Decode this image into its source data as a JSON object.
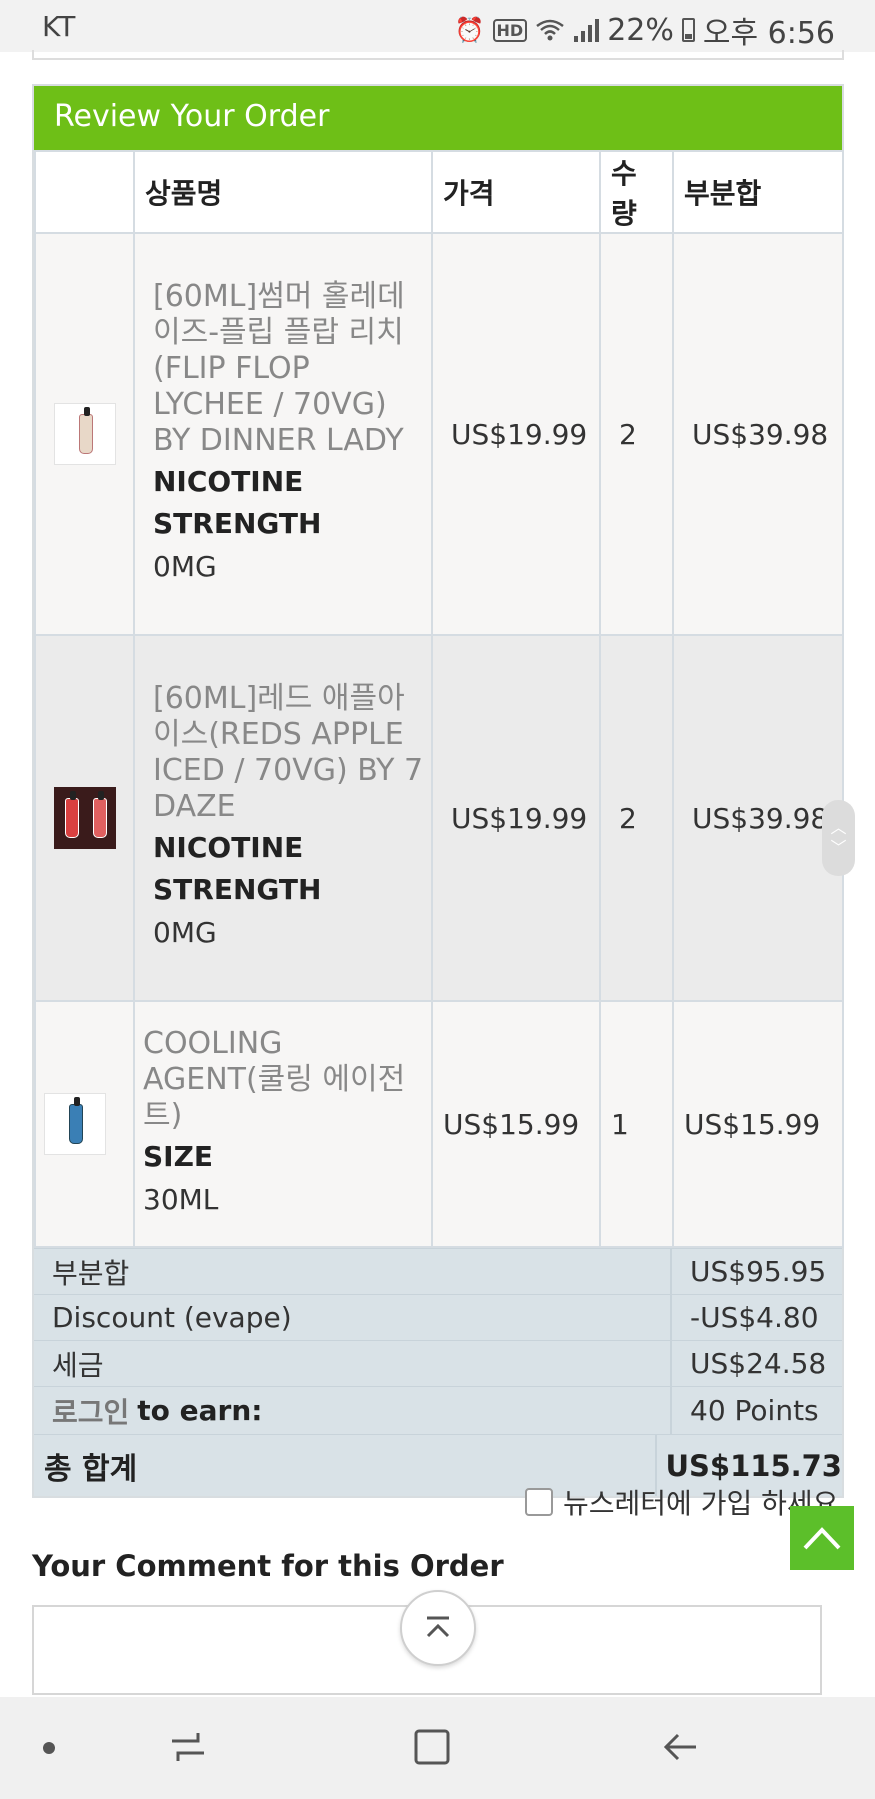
{
  "status_bar": {
    "carrier": "KT",
    "battery": "22%",
    "time": "오후 6:56",
    "icons": [
      "alarm-icon",
      "hd-icon",
      "wifi-icon",
      "signal-icon",
      "battery-icon"
    ]
  },
  "panel": {
    "title": "Review Your Order",
    "header_color": "#6ebf17"
  },
  "table": {
    "headers": [
      "상품명",
      "가격",
      "수량",
      "부분합"
    ],
    "rows": [
      {
        "name": "[60ML]썸머 홀레데이즈-플립 플랍 리치(FLIP FLOP LYCHEE / 70VG) BY DINNER LADY",
        "attr_label": "NICOTINE STRENGTH",
        "attr_value": "0MG",
        "price": "US$19.99",
        "qty": "2",
        "subtotal": "US$39.98"
      },
      {
        "name": "[60ML]레드 애플아이스(REDS APPLE ICED / 70VG) BY 7 DAZE",
        "attr_label": "NICOTINE STRENGTH",
        "attr_value": "0MG",
        "price": "US$19.99",
        "qty": "2",
        "subtotal": "US$39.98"
      },
      {
        "name": "COOLING AGENT(쿨링 에이전트)",
        "attr_label": "SIZE",
        "attr_value": "30ML",
        "price": "US$15.99",
        "qty": "1",
        "subtotal": "US$15.99"
      }
    ]
  },
  "totals": {
    "subtotal_label": "부분합",
    "subtotal_value": "US$95.95",
    "discount_label": "Discount (evape)",
    "discount_value": "-US$4.80",
    "tax_label": "세금",
    "tax_value": "US$24.58",
    "login_link": "로그인",
    "earn_label": "to earn:",
    "points_value": "40 Points",
    "grand_label": "총 합계",
    "grand_value": "US$115.73"
  },
  "newsletter": {
    "label": "뉴스레터에 가입 하세요",
    "checked": false
  },
  "comment": {
    "heading": "Your Comment for this Order",
    "value": ""
  }
}
